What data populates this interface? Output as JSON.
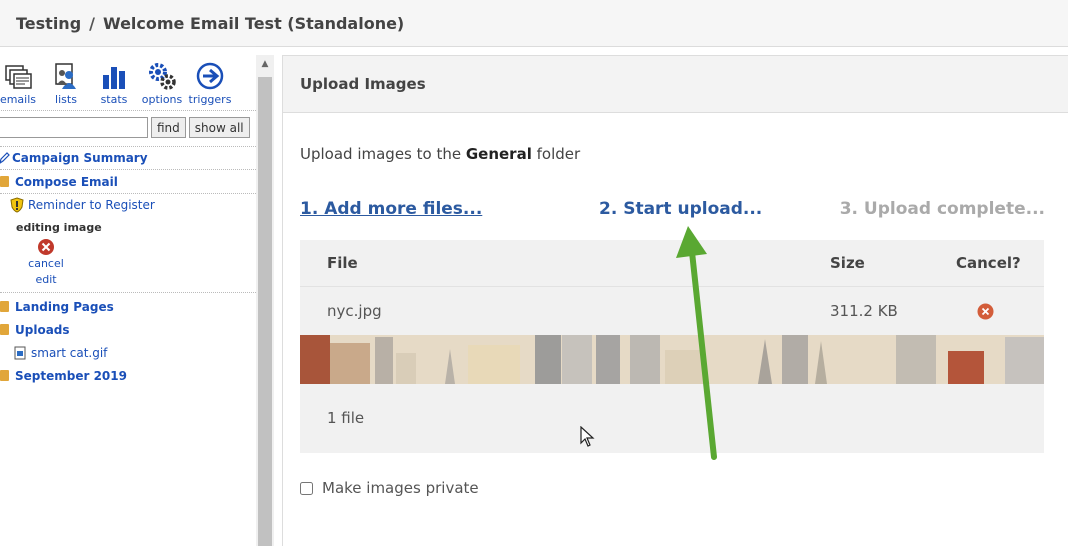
{
  "titlebar": {
    "section": "Testing",
    "separator": "/",
    "title": "Welcome Email Test (Standalone)"
  },
  "sidebar": {
    "toolbar": [
      {
        "label": "emails",
        "icon": "emails-icon"
      },
      {
        "label": "lists",
        "icon": "lists-icon"
      },
      {
        "label": "stats",
        "icon": "stats-icon"
      },
      {
        "label": "options",
        "icon": "gear-icon"
      },
      {
        "label": "triggers",
        "icon": "arrow-right-circle-icon"
      }
    ],
    "search": {
      "value": "",
      "find_label": "find",
      "show_all_label": "show all"
    },
    "tree": {
      "campaign_summary": "Campaign Summary",
      "compose_email": "Compose Email",
      "reminder": "Reminder to Register",
      "editing_image": "editing image",
      "cancel": "cancel",
      "edit": "edit",
      "landing_pages": "Landing Pages",
      "uploads": "Uploads",
      "smart_cat": "smart cat.gif",
      "september": "September 2019"
    }
  },
  "panel": {
    "title": "Upload Images",
    "intro_prefix": "Upload images to the ",
    "intro_folder": "General",
    "intro_suffix": " folder",
    "steps": {
      "add": "1. Add more files...",
      "start": "2. Start upload...",
      "complete": "3. Upload complete..."
    },
    "table": {
      "headers": {
        "file": "File",
        "size": "Size",
        "cancel": "Cancel?"
      },
      "rows": [
        {
          "name": "nyc.jpg",
          "size": "311.2 KB"
        }
      ],
      "footer": "1 file"
    },
    "private_label": "Make images private"
  },
  "colors": {
    "link": "#1a4fb8",
    "step": "#2c5aa0",
    "folder": "#e1a63a",
    "cancel": "#c0392b",
    "arrow": "#5aa832"
  }
}
